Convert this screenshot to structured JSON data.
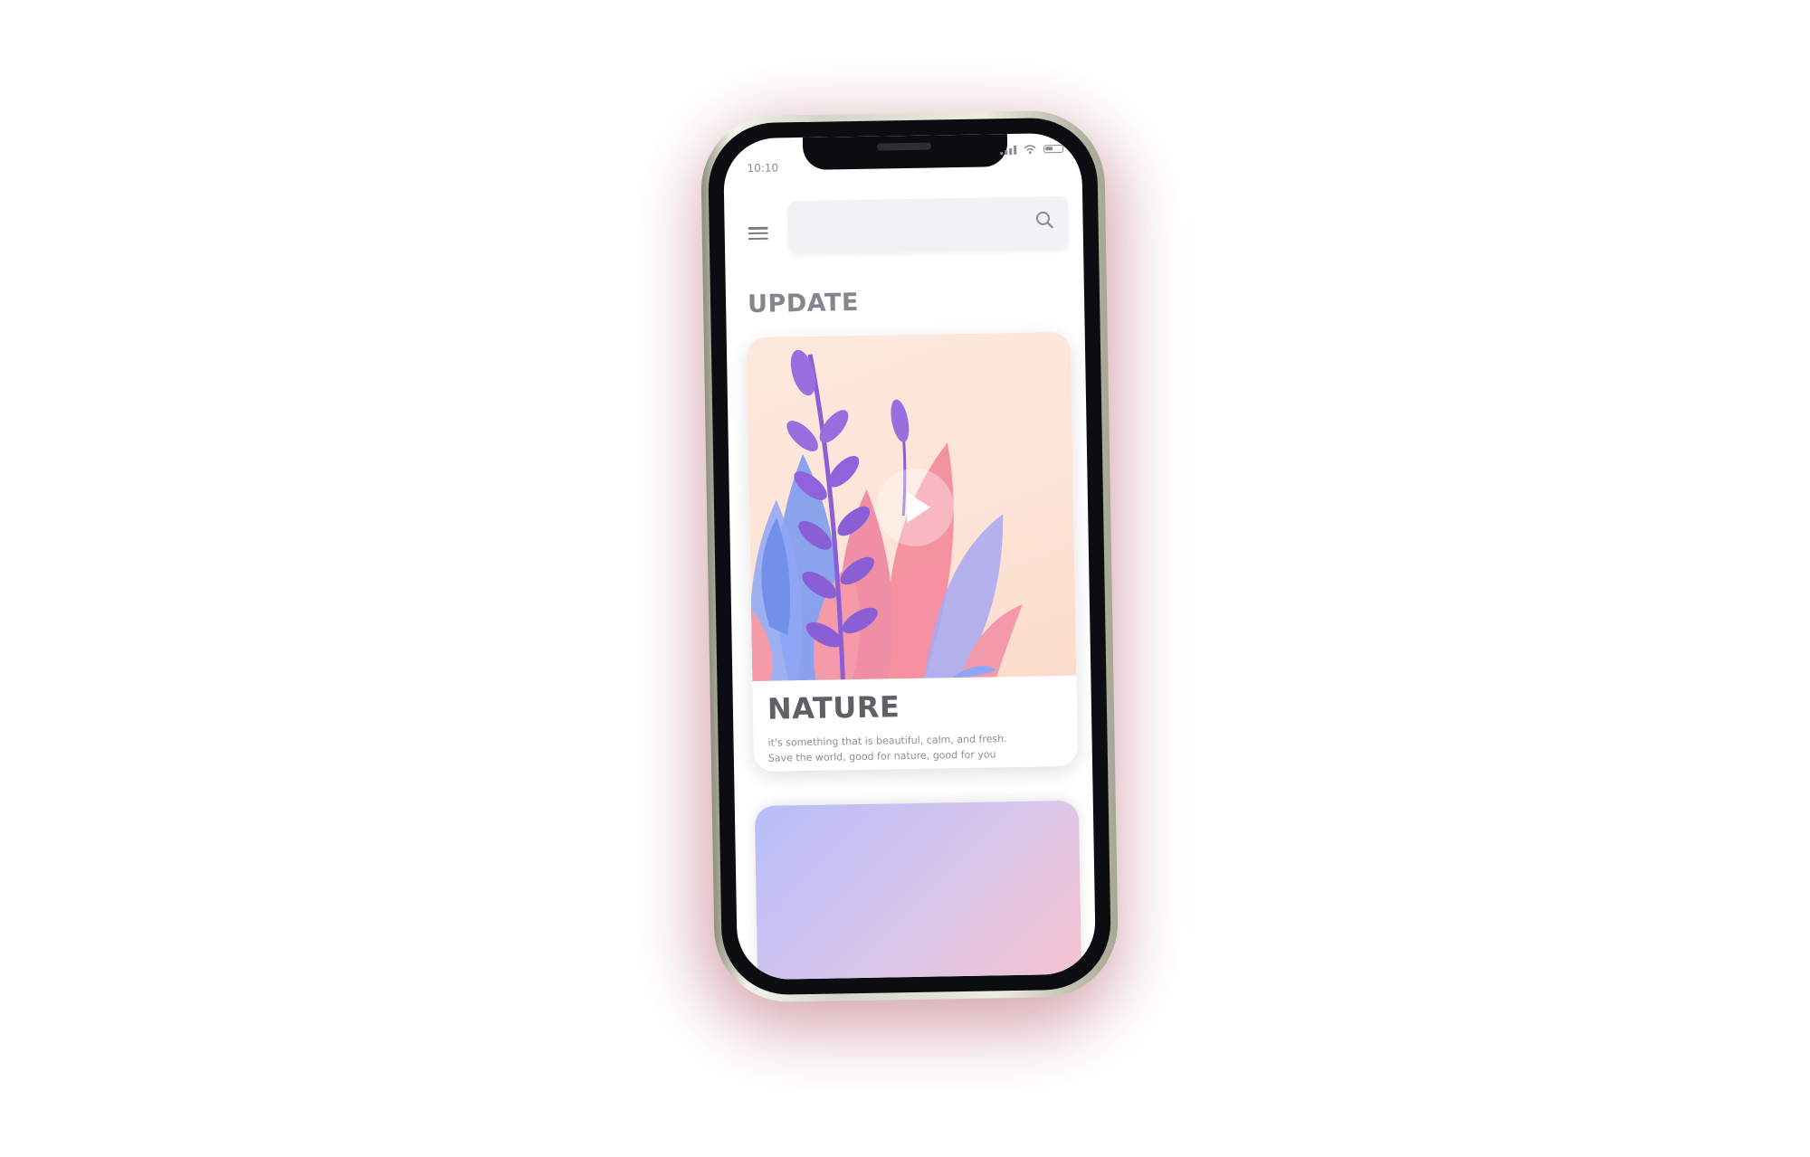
{
  "status_bar": {
    "time": "10:10",
    "icons": [
      "signal-icon",
      "wifi-icon",
      "battery-icon"
    ]
  },
  "header": {
    "menu_icon": "menu-icon",
    "search": {
      "value": "",
      "placeholder": "",
      "icon": "search-icon"
    }
  },
  "section": {
    "title": "UPDATE"
  },
  "cards": [
    {
      "title": "NATURE",
      "description_line1": "it's something that is beautiful, calm, and fresh.",
      "description_line2": "Save the world, good for nature, good for you",
      "play_icon": "play-icon"
    }
  ],
  "colors": {
    "glow": "#9e1e34",
    "title_text": "#85858d",
    "card_title": "#5f5f66",
    "art_background": "#fde6da",
    "card2_gradient_start": "#b8bdfb",
    "card2_gradient_end": "#f7c2cf"
  }
}
